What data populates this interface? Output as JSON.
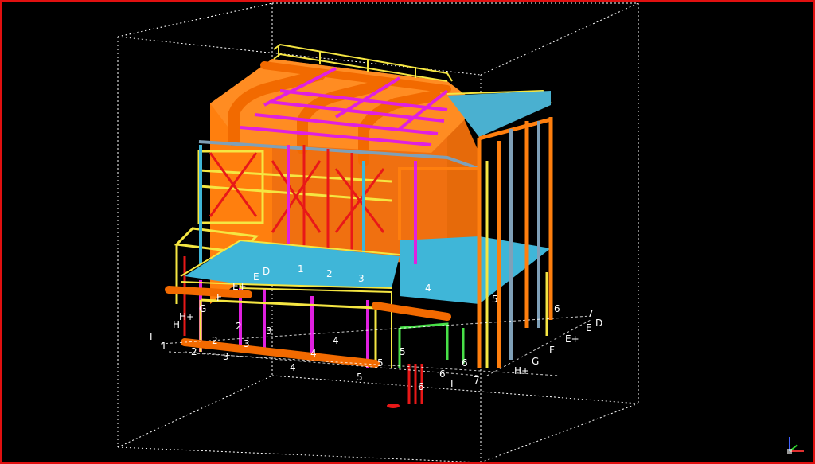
{
  "viewer": {
    "frame_color": "#e01010",
    "background": "#000000",
    "bounding_box_style": "dashed-white"
  },
  "colors": {
    "structure_orange": "#ff7f0e",
    "pipe_orange": "#f26a00",
    "handrail_yellow": "#f5e642",
    "bracing_red": "#e81818",
    "member_magenta": "#e020e0",
    "grating_cyan": "#3fb6d8",
    "handrail_green": "#48e048",
    "column_steel": "#7fa0b8"
  },
  "grid_labels": {
    "front_numbers": [
      "1",
      "2",
      "3",
      "4",
      "5",
      "6",
      "7"
    ],
    "left_letters": [
      "D",
      "E",
      "E+",
      "F",
      "G",
      "H",
      "H+",
      "I"
    ],
    "right_letters": [
      "D",
      "E",
      "E+",
      "F",
      "G",
      "H+",
      "I"
    ],
    "upper_numbers": [
      "1",
      "2",
      "3",
      "4",
      "5",
      "6"
    ]
  },
  "axis_widget": "xyz-triad-icon"
}
